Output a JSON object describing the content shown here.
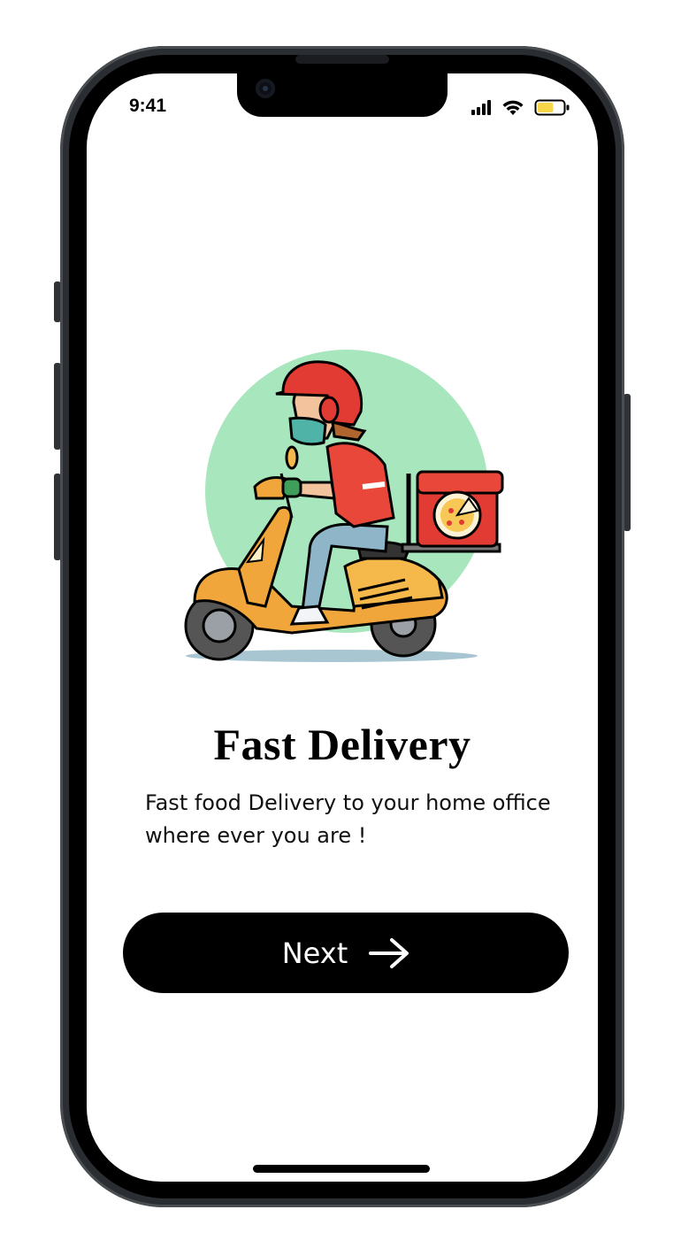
{
  "status_bar": {
    "time": "9:41",
    "signal_icon": "cellular-signal-icon",
    "wifi_icon": "wifi-icon",
    "battery_icon": "battery-icon",
    "battery_level": 0.6,
    "battery_color": "#f7d64a"
  },
  "illustration": {
    "icon": "delivery-scooter-illustration",
    "background_circle_color": "#a8e6be"
  },
  "onboarding": {
    "title": "Fast Delivery",
    "description": "Fast food Delivery to your home office where ever you are !",
    "next_label": "Next",
    "next_icon": "arrow-right-icon"
  }
}
